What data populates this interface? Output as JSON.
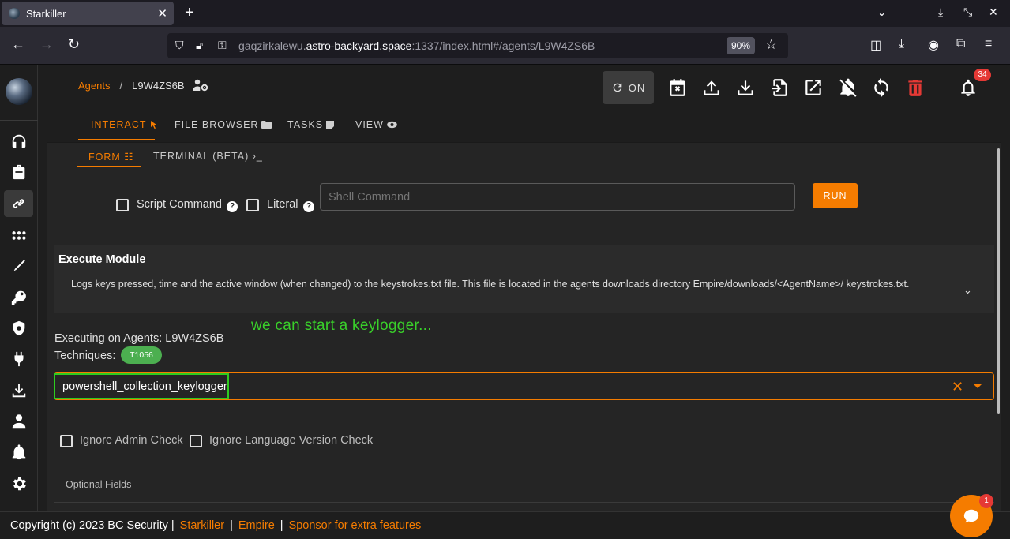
{
  "browser": {
    "tab_title": "Starkiller",
    "url_prefix": "gaqzirkalewu.",
    "url_domain": "astro-backyard.space",
    "url_suffix": ":1337/index.html#/agents/L9W4ZS6B",
    "zoom": "90%"
  },
  "breadcrumb": {
    "root": "Agents",
    "separator": "/",
    "current": "L9W4ZS6B"
  },
  "toolbar": {
    "on_label": "ON",
    "notification_count": "34"
  },
  "main_tabs": [
    "INTERACT",
    "FILE BROWSER",
    "TASKS",
    "VIEW"
  ],
  "sub_tabs": [
    "FORM",
    "TERMINAL (BETA)"
  ],
  "command_form": {
    "script_command_label": "Script Command",
    "literal_label": "Literal",
    "help_glyph": "?",
    "shell_placeholder": "Shell Command",
    "run_label": "RUN"
  },
  "execute_module": {
    "title": "Execute Module",
    "description": "Logs keys pressed, time and the active window (when changed) to the keystrokes.txt file. This file is located in the agents downloads directory Empire/downloads/<AgentName>/ keystrokes.txt.",
    "executing_on": "Executing on Agents: L9W4ZS6B",
    "techniques_label": "Techniques:",
    "technique": "T1056",
    "selected_module": "powershell_collection_keylogger",
    "ignore_admin_label": "Ignore Admin Check",
    "ignore_lang_label": "Ignore Language Version Check",
    "optional_fields_label": "Optional Fields"
  },
  "annotation": "we can start a keylogger...",
  "footer": {
    "copyright": "Copyright (c) 2023 BC Security |",
    "link_starkiller": "Starkiller",
    "link_empire": "Empire",
    "link_sponsor": "Sponsor for extra features",
    "pipe": "|"
  },
  "chat": {
    "badge": "1"
  },
  "colors": {
    "accent": "#f57c00",
    "chip_green": "#4caf50",
    "annotation_green": "#39d02a",
    "danger": "#e53935"
  }
}
